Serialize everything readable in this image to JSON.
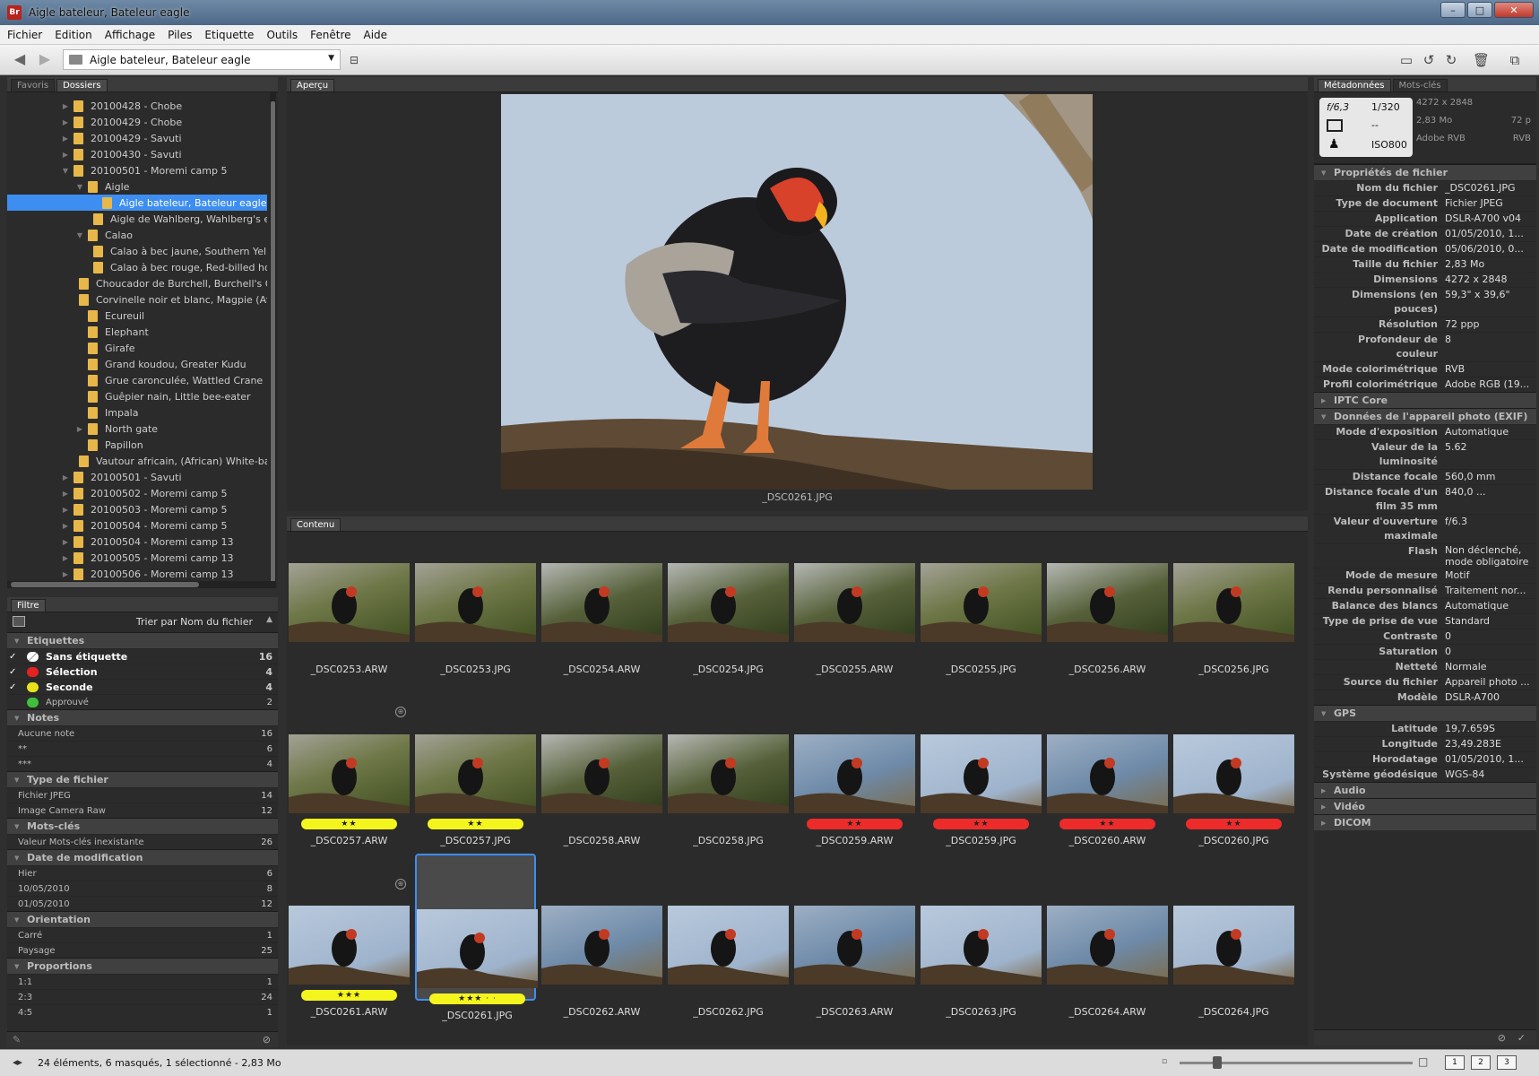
{
  "window": {
    "app_icon": "Br",
    "title": "Aigle bateleur, Bateleur eagle"
  },
  "menu": [
    "Fichier",
    "Edition",
    "Affichage",
    "Piles",
    "Etiquette",
    "Outils",
    "Fenêtre",
    "Aide"
  ],
  "path": {
    "current": "Aigle bateleur, Bateleur eagle"
  },
  "left_tabs": {
    "favorites": "Favoris",
    "folders": "Dossiers"
  },
  "folders": [
    {
      "label": "20100428 - Chobe",
      "depth": 0,
      "state": "collapsed"
    },
    {
      "label": "20100429 - Chobe",
      "depth": 0,
      "state": "collapsed"
    },
    {
      "label": "20100429 - Savuti",
      "depth": 0,
      "state": "collapsed"
    },
    {
      "label": "20100430 - Savuti",
      "depth": 0,
      "state": "collapsed"
    },
    {
      "label": "20100501 - Moremi camp 5",
      "depth": 0,
      "state": "expanded"
    },
    {
      "label": "Aigle",
      "depth": 1,
      "state": "expanded"
    },
    {
      "label": "Aigle bateleur, Bateleur eagle",
      "depth": 2,
      "state": "selected"
    },
    {
      "label": "Aigle de Wahlberg, Wahlberg's e",
      "depth": 2,
      "state": "none"
    },
    {
      "label": "Calao",
      "depth": 1,
      "state": "expanded"
    },
    {
      "label": "Calao à bec jaune, Southern Yell",
      "depth": 2,
      "state": "none"
    },
    {
      "label": "Calao à bec rouge, Red-billed ho",
      "depth": 2,
      "state": "none"
    },
    {
      "label": "Choucador de Burchell, Burchell's Gl",
      "depth": 1,
      "state": "none"
    },
    {
      "label": "Corvinelle noir et blanc, Magpie (Afr",
      "depth": 1,
      "state": "none"
    },
    {
      "label": "Ecureuil",
      "depth": 1,
      "state": "none"
    },
    {
      "label": "Elephant",
      "depth": 1,
      "state": "none"
    },
    {
      "label": "Girafe",
      "depth": 1,
      "state": "none"
    },
    {
      "label": "Grand koudou, Greater Kudu",
      "depth": 1,
      "state": "none"
    },
    {
      "label": "Grue caronculée, Wattled Crane",
      "depth": 1,
      "state": "none"
    },
    {
      "label": "Guêpier nain, Little bee-eater",
      "depth": 1,
      "state": "none"
    },
    {
      "label": "Impala",
      "depth": 1,
      "state": "none"
    },
    {
      "label": "North gate",
      "depth": 1,
      "state": "collapsed"
    },
    {
      "label": "Papillon",
      "depth": 1,
      "state": "none"
    },
    {
      "label": "Vautour africain, (African) White-ba",
      "depth": 1,
      "state": "none"
    },
    {
      "label": "20100501 - Savuti",
      "depth": 0,
      "state": "collapsed"
    },
    {
      "label": "20100502 - Moremi camp 5",
      "depth": 0,
      "state": "collapsed"
    },
    {
      "label": "20100503 - Moremi camp 5",
      "depth": 0,
      "state": "collapsed"
    },
    {
      "label": "20100504 - Moremi camp 5",
      "depth": 0,
      "state": "collapsed"
    },
    {
      "label": "20100504 - Moremi camp 13",
      "depth": 0,
      "state": "collapsed"
    },
    {
      "label": "20100505 - Moremi camp 13",
      "depth": 0,
      "state": "collapsed"
    },
    {
      "label": "20100506 - Moremi camp 13",
      "depth": 0,
      "state": "collapsed"
    }
  ],
  "filter": {
    "tab": "Filtre",
    "sort": "Trier par Nom du fichier",
    "sections": [
      {
        "title": "Etiquettes",
        "rows": [
          {
            "label": "Sans étiquette",
            "count": "16",
            "checked": true,
            "bold": true,
            "swatch": "none"
          },
          {
            "label": "Sélection",
            "count": "4",
            "checked": true,
            "bold": true,
            "swatch": "#e32222"
          },
          {
            "label": "Seconde",
            "count": "4",
            "checked": true,
            "bold": true,
            "swatch": "#e8e21c"
          },
          {
            "label": "Approuvé",
            "count": "2",
            "checked": false,
            "bold": false,
            "swatch": "#3fc03a"
          }
        ]
      },
      {
        "title": "Notes",
        "rows": [
          {
            "label": "Aucune note",
            "count": "16"
          },
          {
            "label": "**",
            "count": "6"
          },
          {
            "label": "***",
            "count": "4"
          }
        ]
      },
      {
        "title": "Type de fichier",
        "rows": [
          {
            "label": "Fichier JPEG",
            "count": "14"
          },
          {
            "label": "Image Camera Raw",
            "count": "12"
          }
        ]
      },
      {
        "title": "Mots-clés",
        "rows": [
          {
            "label": "Valeur Mots-clés inexistante",
            "count": "26"
          }
        ]
      },
      {
        "title": "Date de modification",
        "rows": [
          {
            "label": "Hier",
            "count": "6"
          },
          {
            "label": "10/05/2010",
            "count": "8"
          },
          {
            "label": "01/05/2010",
            "count": "12"
          }
        ]
      },
      {
        "title": "Orientation",
        "rows": [
          {
            "label": "Carré",
            "count": "1"
          },
          {
            "label": "Paysage",
            "count": "25"
          }
        ]
      },
      {
        "title": "Proportions",
        "rows": [
          {
            "label": "1:1",
            "count": "1"
          },
          {
            "label": "2:3",
            "count": "24"
          },
          {
            "label": "4:5",
            "count": "1"
          }
        ]
      }
    ]
  },
  "preview": {
    "tab": "Aperçu",
    "caption": "_DSC0261.JPG"
  },
  "content": {
    "tab": "Contenu",
    "items": [
      {
        "name": "_DSC0253.ARW",
        "style": "forest",
        "bar": "",
        "stars": ""
      },
      {
        "name": "_DSC0253.JPG",
        "style": "forest",
        "bar": "",
        "stars": ""
      },
      {
        "name": "_DSC0254.ARW",
        "style": "dark",
        "bar": "",
        "stars": ""
      },
      {
        "name": "_DSC0254.JPG",
        "style": "dark",
        "bar": "",
        "stars": ""
      },
      {
        "name": "_DSC0255.ARW",
        "style": "dark",
        "bar": "",
        "stars": ""
      },
      {
        "name": "_DSC0255.JPG",
        "style": "forest",
        "bar": "",
        "stars": ""
      },
      {
        "name": "_DSC0256.ARW",
        "style": "dark",
        "bar": "",
        "stars": ""
      },
      {
        "name": "_DSC0256.JPG",
        "style": "forest",
        "bar": "",
        "stars": ""
      },
      {
        "name": "_DSC0257.ARW",
        "style": "forest",
        "bar": "yellow",
        "stars": "★★"
      },
      {
        "name": "_DSC0257.JPG",
        "style": "forest",
        "bar": "yellow",
        "stars": "★★"
      },
      {
        "name": "_DSC0258.ARW",
        "style": "dark",
        "bar": "",
        "stars": ""
      },
      {
        "name": "_DSC0258.JPG",
        "style": "dark",
        "bar": "",
        "stars": ""
      },
      {
        "name": "_DSC0259.ARW",
        "style": "bright",
        "bar": "red",
        "stars": "★★"
      },
      {
        "name": "_DSC0259.JPG",
        "style": "sky",
        "bar": "red",
        "stars": "★★"
      },
      {
        "name": "_DSC0260.ARW",
        "style": "bright",
        "bar": "red",
        "stars": "★★"
      },
      {
        "name": "_DSC0260.JPG",
        "style": "sky",
        "bar": "red",
        "stars": "★★"
      },
      {
        "name": "_DSC0261.ARW",
        "style": "sky",
        "bar": "yellow",
        "stars": "★★★"
      },
      {
        "name": "_DSC0261.JPG",
        "style": "sky",
        "bar": "yellow",
        "stars": "★★★ · ·",
        "selected": true
      },
      {
        "name": "_DSC0262.ARW",
        "style": "bright",
        "bar": "",
        "stars": ""
      },
      {
        "name": "_DSC0262.JPG",
        "style": "sky",
        "bar": "",
        "stars": ""
      },
      {
        "name": "_DSC0263.ARW",
        "style": "bright",
        "bar": "",
        "stars": ""
      },
      {
        "name": "_DSC0263.JPG",
        "style": "sky",
        "bar": "",
        "stars": ""
      },
      {
        "name": "_DSC0264.ARW",
        "style": "bright",
        "bar": "",
        "stars": ""
      },
      {
        "name": "_DSC0264.JPG",
        "style": "sky",
        "bar": "",
        "stars": ""
      }
    ]
  },
  "metadata": {
    "tabs": {
      "meta": "Métadonnées",
      "keywords": "Mots-clés"
    },
    "summary": {
      "aperture": "f/6,3",
      "shutter": "1/320",
      "metering": "--",
      "iso": "ISO800",
      "dimensions": "4272 x 2848",
      "size": "2,83 Mo",
      "resolution": "72 p",
      "profile": "Adobe RVB",
      "mode": "RVB"
    },
    "sections": [
      {
        "title": "Propriétés de fichier",
        "open": true,
        "rows": [
          {
            "k": "Nom du fichier",
            "v": "_DSC0261.JPG"
          },
          {
            "k": "Type de document",
            "v": "Fichier JPEG"
          },
          {
            "k": "Application",
            "v": "DSLR-A700 v04"
          },
          {
            "k": "Date de création",
            "v": "01/05/2010, 1..."
          },
          {
            "k": "Date de modification",
            "v": "05/06/2010, 0..."
          },
          {
            "k": "Taille du fichier",
            "v": "2,83 Mo"
          },
          {
            "k": "Dimensions",
            "v": "4272 x 2848"
          },
          {
            "k": "Dimensions (en pouces)",
            "v": "59,3\" x 39,6\""
          },
          {
            "k": "Résolution",
            "v": "72 ppp"
          },
          {
            "k": "Profondeur de couleur",
            "v": "8"
          },
          {
            "k": "Mode colorimétrique",
            "v": "RVB"
          },
          {
            "k": "Profil colorimétrique",
            "v": "Adobe RGB (19..."
          }
        ]
      },
      {
        "title": "IPTC Core",
        "open": false,
        "rows": []
      },
      {
        "title": "Données de l'appareil photo (EXIF)",
        "open": true,
        "rows": [
          {
            "k": "Mode d'exposition",
            "v": "Automatique"
          },
          {
            "k": "Valeur de la luminosité",
            "v": "5.62"
          },
          {
            "k": "Distance focale",
            "v": "560,0 mm"
          },
          {
            "k": "Distance focale d'un film 35 mm",
            "v": "840,0 ..."
          },
          {
            "k": "Valeur d'ouverture maximale",
            "v": "f/6.3"
          },
          {
            "k": "Flash",
            "v": "Non déclenché, mode obligatoire"
          },
          {
            "k": "Mode de mesure",
            "v": "Motif"
          },
          {
            "k": "Rendu personnalisé",
            "v": "Traitement nor..."
          },
          {
            "k": "Balance des blancs",
            "v": "Automatique"
          },
          {
            "k": "Type de prise de vue",
            "v": "Standard"
          },
          {
            "k": "Contraste",
            "v": "0"
          },
          {
            "k": "Saturation",
            "v": "0"
          },
          {
            "k": "Netteté",
            "v": "Normale"
          },
          {
            "k": "Source du fichier",
            "v": "Appareil photo ..."
          },
          {
            "k": "Modèle",
            "v": "DSLR-A700"
          }
        ]
      },
      {
        "title": "GPS",
        "open": true,
        "rows": [
          {
            "k": "Latitude",
            "v": "19,7.659S"
          },
          {
            "k": "Longitude",
            "v": "23,49.283E"
          },
          {
            "k": "Horodatage",
            "v": "01/05/2010, 1..."
          },
          {
            "k": "Système géodésique",
            "v": "WGS-84"
          }
        ]
      },
      {
        "title": "Audio",
        "open": false,
        "rows": []
      },
      {
        "title": "Vidéo",
        "open": false,
        "rows": []
      },
      {
        "title": "DICOM",
        "open": false,
        "rows": []
      }
    ]
  },
  "status": {
    "text": "24 éléments, 6 masqués, 1 sélectionné - 2,83 Mo",
    "views": [
      "1",
      "2",
      "3"
    ]
  },
  "colors": {
    "selection": "#3d8ef0",
    "yellow_label": "#f5f51e",
    "red_label": "#ee2b2b",
    "panel_bg": "#2b2b2b"
  }
}
